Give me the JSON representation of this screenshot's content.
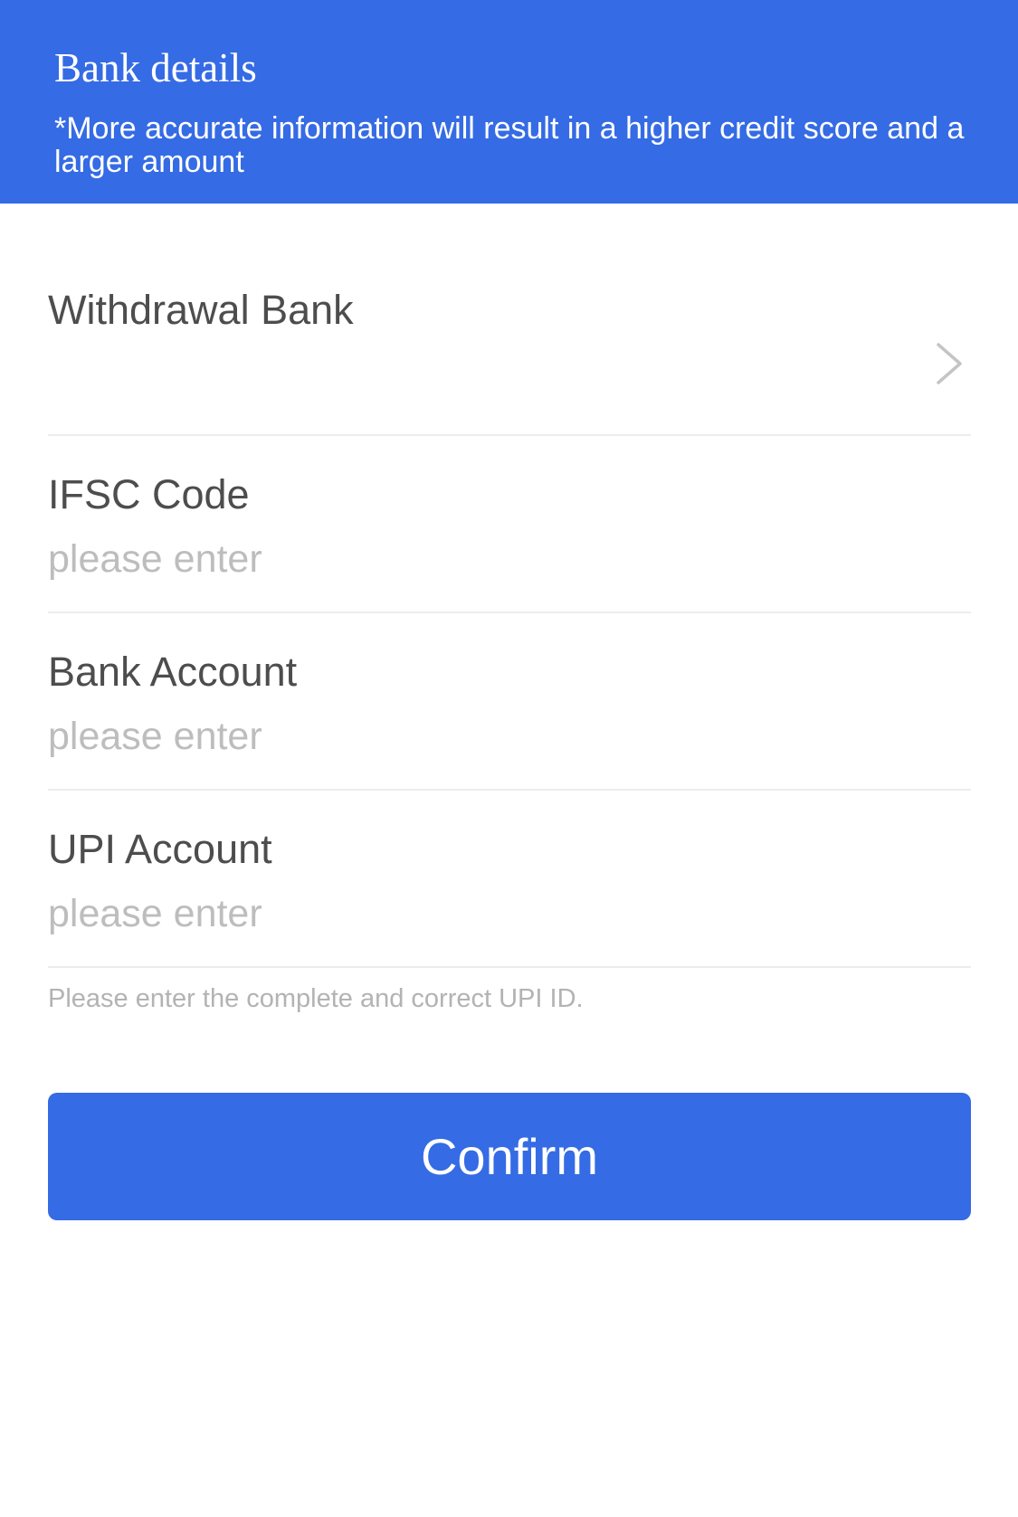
{
  "header": {
    "title": "Bank details",
    "subtitle": "*More accurate information will result in a higher credit score and a larger amount"
  },
  "form": {
    "withdrawal_bank": {
      "label": "Withdrawal Bank",
      "icon": "chevron-right-icon"
    },
    "ifsc_code": {
      "label": "IFSC Code",
      "placeholder": "please enter",
      "value": ""
    },
    "bank_account": {
      "label": "Bank Account",
      "placeholder": "please enter",
      "value": ""
    },
    "upi_account": {
      "label": "UPI Account",
      "placeholder": "please enter",
      "value": ""
    },
    "hint": "Please enter the complete and correct UPI ID."
  },
  "confirm_button": {
    "label": "Confirm"
  },
  "colors": {
    "accent": "#356be4",
    "label_text": "#4d4d4d",
    "placeholder_text": "#bdbdbd",
    "hint_text": "#b3b3b3",
    "divider": "#ececec"
  }
}
